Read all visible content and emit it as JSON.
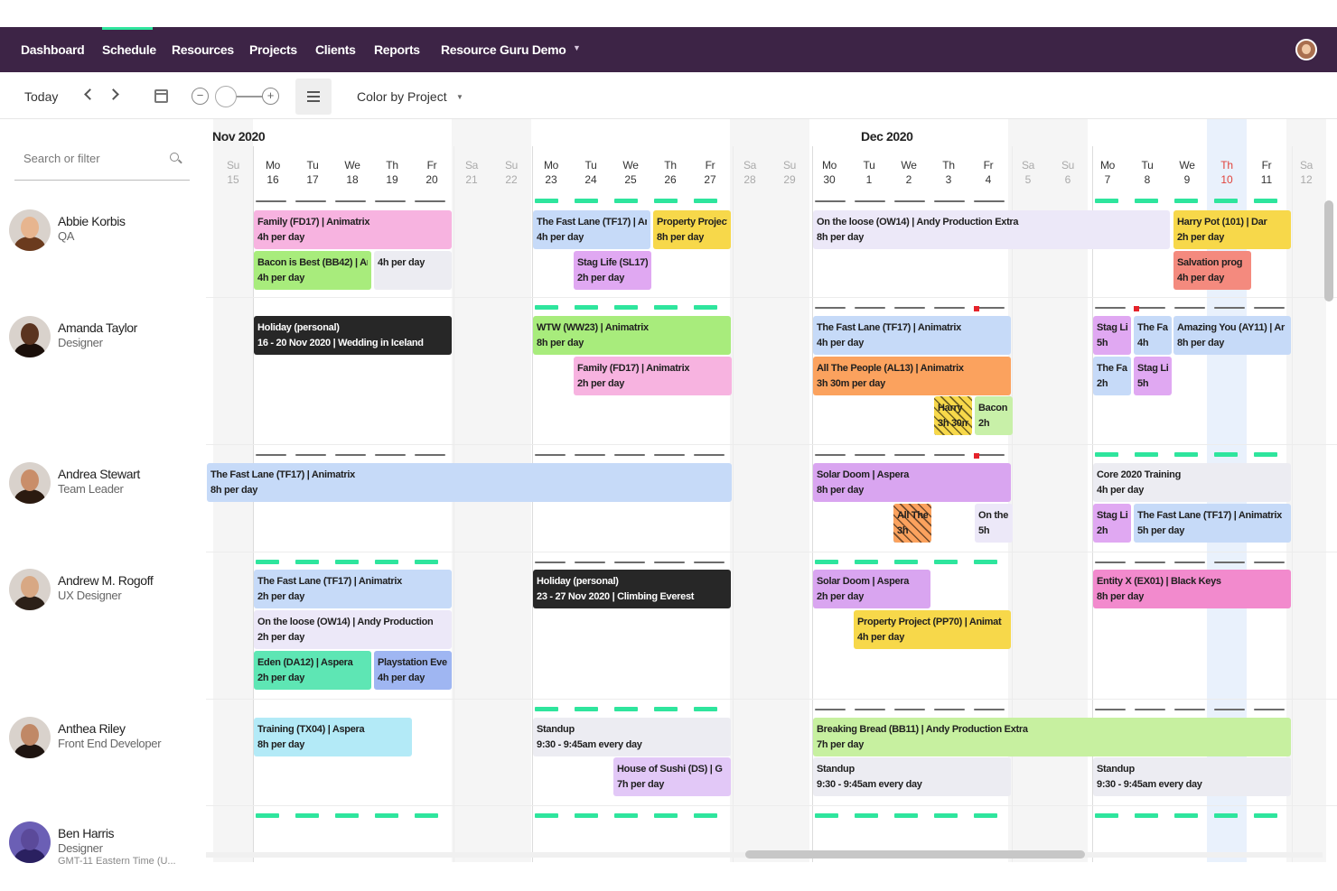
{
  "nav": {
    "items": [
      "Dashboard",
      "Schedule",
      "Resources",
      "Projects",
      "Clients",
      "Reports",
      "Resource Guru Demo"
    ],
    "active": "Schedule",
    "accent": "#2ee59d",
    "bar_color": "#3d2446"
  },
  "toolbar": {
    "today_label": "Today",
    "color_by_label": "Color by Project",
    "zoom_out_symbol": "−",
    "zoom_in_symbol": "+"
  },
  "search": {
    "placeholder": "Search or filter"
  },
  "months": [
    "Nov 2020",
    "Dec 2020"
  ],
  "days": [
    {
      "wd": "Su",
      "dn": "15",
      "weekend": true
    },
    {
      "wd": "Mo",
      "dn": "16"
    },
    {
      "wd": "Tu",
      "dn": "17"
    },
    {
      "wd": "We",
      "dn": "18"
    },
    {
      "wd": "Th",
      "dn": "19"
    },
    {
      "wd": "Fr",
      "dn": "20"
    },
    {
      "wd": "Sa",
      "dn": "21",
      "weekend": true
    },
    {
      "wd": "Su",
      "dn": "22",
      "weekend": true
    },
    {
      "wd": "Mo",
      "dn": "23"
    },
    {
      "wd": "Tu",
      "dn": "24"
    },
    {
      "wd": "We",
      "dn": "25"
    },
    {
      "wd": "Th",
      "dn": "26"
    },
    {
      "wd": "Fr",
      "dn": "27"
    },
    {
      "wd": "Sa",
      "dn": "28",
      "weekend": true
    },
    {
      "wd": "Su",
      "dn": "29",
      "weekend": true
    },
    {
      "wd": "Mo",
      "dn": "30"
    },
    {
      "wd": "Tu",
      "dn": "1"
    },
    {
      "wd": "We",
      "dn": "2"
    },
    {
      "wd": "Th",
      "dn": "3"
    },
    {
      "wd": "Fr",
      "dn": "4"
    },
    {
      "wd": "Sa",
      "dn": "5",
      "weekend": true
    },
    {
      "wd": "Su",
      "dn": "6",
      "weekend": true
    },
    {
      "wd": "Mo",
      "dn": "7"
    },
    {
      "wd": "Tu",
      "dn": "8"
    },
    {
      "wd": "We",
      "dn": "9"
    },
    {
      "wd": "Th",
      "dn": "10",
      "today": true
    },
    {
      "wd": "Fr",
      "dn": "11"
    },
    {
      "wd": "Sa",
      "dn": "12",
      "weekend": true
    }
  ],
  "people": [
    {
      "name": "Abbie Korbis",
      "role": "QA",
      "skin": "#e7b58f",
      "hair": "#6b3b1e"
    },
    {
      "name": "Amanda Taylor",
      "role": "Designer",
      "skin": "#5a3420",
      "hair": "#1a0f0a"
    },
    {
      "name": "Andrea Stewart",
      "role": "Team Leader",
      "skin": "#c98e6a",
      "hair": "#2b1a10"
    },
    {
      "name": "Andrew M. Rogoff",
      "role": "UX Designer",
      "skin": "#d8a884",
      "hair": "#2c2018"
    },
    {
      "name": "Anthea Riley",
      "role": "Front End Developer",
      "skin": "#c08866",
      "hair": "#1e1410"
    },
    {
      "name": "Ben Harris",
      "role": "Designer",
      "extra": "GMT-11 Eastern Time (U...",
      "skin": "#5b4a9a",
      "hair": "#2a2060"
    }
  ],
  "bookings": [
    {
      "row": 0,
      "title": "Family (FD17) | Animatrix",
      "sub": "4h per day",
      "color": "#f7b3e0"
    },
    {
      "row": 0,
      "title": "Bacon is Best (BB42) | Ar",
      "sub": "4h per day",
      "color": "#a8ec7c"
    },
    {
      "row": 0,
      "title": "4h per day",
      "sub": "",
      "color": "#ececf2"
    },
    {
      "row": 0,
      "title": "The Fast Lane (TF17) | Ar",
      "sub": "4h per day",
      "color": "#c6daf8"
    },
    {
      "row": 0,
      "title": "Property Project",
      "sub": "8h per day",
      "color": "#f7d84a"
    },
    {
      "row": 0,
      "title": "Stag Life (SL17)",
      "sub": "2h per day",
      "color": "#e0a8f2"
    },
    {
      "row": 0,
      "title": "On the loose (OW14) | Andy Production Extra",
      "sub": "8h per day",
      "color": "#ece8f8"
    },
    {
      "row": 0,
      "title": "Harry Pot (101) | Dar",
      "sub": "2h per day",
      "color": "#f7d84a"
    },
    {
      "row": 0,
      "title": "Salvation prog",
      "sub": "4h per day",
      "color": "#f48a7e"
    },
    {
      "row": 1,
      "title": "Holiday (personal)",
      "sub": "16 - 20 Nov 2020 | Wedding in Iceland",
      "color": "#272727",
      "dark": true
    },
    {
      "row": 1,
      "title": "WTW (WW23) | Animatrix",
      "sub": "8h per day",
      "color": "#a8ec7c"
    },
    {
      "row": 1,
      "title": "Family (FD17) | Animatrix",
      "sub": "2h per day",
      "color": "#f7b3e0"
    },
    {
      "row": 1,
      "title": "The Fast Lane (TF17) | Animatrix",
      "sub": "4h per day",
      "color": "#c6daf8"
    },
    {
      "row": 1,
      "title": "All The People (AL13) | Animatrix",
      "sub": "3h 30m per day",
      "color": "#fba25e"
    },
    {
      "row": 1,
      "title": "Harry",
      "sub": "3h 30m",
      "color": "#f7d84a",
      "hatch": true
    },
    {
      "row": 1,
      "title": "Bacon",
      "sub": "2h",
      "color": "#c8f0a8"
    },
    {
      "row": 1,
      "title": "Stag Li",
      "sub": "5h",
      "color": "#e0a8f2"
    },
    {
      "row": 1,
      "title": "The Fa",
      "sub": "4h",
      "color": "#c6daf8"
    },
    {
      "row": 1,
      "title": "Amazing You (AY11) | Ar",
      "sub": "8h per day",
      "color": "#c6daf8"
    },
    {
      "row": 1,
      "title": "The Fa",
      "sub": "2h",
      "color": "#c6daf8"
    },
    {
      "row": 1,
      "title": "Stag Li",
      "sub": "5h",
      "color": "#e0a8f2"
    },
    {
      "row": 2,
      "title": "The Fast Lane (TF17) | Animatrix",
      "sub": "8h per day",
      "color": "#c6daf8"
    },
    {
      "row": 2,
      "title": "Solar Doom | Aspera",
      "sub": "8h per day",
      "color": "#d9a5f0"
    },
    {
      "row": 2,
      "title": "All The",
      "sub": "3h",
      "color": "#fba25e",
      "hatch": true
    },
    {
      "row": 2,
      "title": "On the",
      "sub": "5h",
      "color": "#ece8f8"
    },
    {
      "row": 2,
      "title": "Core 2020 Training",
      "sub": "4h per day",
      "color": "#ececf2"
    },
    {
      "row": 2,
      "title": "Stag Li",
      "sub": "2h",
      "color": "#e0a8f2"
    },
    {
      "row": 2,
      "title": "The Fast Lane (TF17) | Animatrix",
      "sub": "5h per day",
      "color": "#c6daf8"
    },
    {
      "row": 3,
      "title": "The Fast Lane (TF17) | Animatrix",
      "sub": "2h per day",
      "color": "#c6daf8"
    },
    {
      "row": 3,
      "title": "On the loose (OW14) | Andy Production",
      "sub": "2h per day",
      "color": "#ece8f8"
    },
    {
      "row": 3,
      "title": "Eden (DA12) | Aspera",
      "sub": "2h per day",
      "color": "#5ee6b4"
    },
    {
      "row": 3,
      "title": "Playstation Eve",
      "sub": "4h per day",
      "color": "#9fb6f2"
    },
    {
      "row": 3,
      "title": "Holiday (personal)",
      "sub": "23 - 27 Nov 2020 | Climbing Everest",
      "color": "#272727",
      "dark": true
    },
    {
      "row": 3,
      "title": "Solar Doom | Aspera",
      "sub": "2h per day",
      "color": "#d9a5f0"
    },
    {
      "row": 3,
      "title": "Property Project (PP70) | Animat",
      "sub": "4h per day",
      "color": "#f7d84a"
    },
    {
      "row": 3,
      "title": "Entity X (EX01) | Black Keys",
      "sub": "8h per day",
      "color": "#f28acd"
    },
    {
      "row": 4,
      "title": "Training (TX04) | Aspera",
      "sub": "8h per day",
      "color": "#b3eaf7"
    },
    {
      "row": 4,
      "title": "Standup",
      "sub": "9:30 - 9:45am every day",
      "color": "#ececf2"
    },
    {
      "row": 4,
      "title": "House of Sushi (DS) | G",
      "sub": "7h per day",
      "color": "#e2c8f7"
    },
    {
      "row": 4,
      "title": "Breaking Bread (BB11) | Andy Production Extra",
      "sub": "7h per day",
      "color": "#c7f0a0"
    },
    {
      "row": 4,
      "title": "Standup",
      "sub": "9:30 - 9:45am every day",
      "color": "#ececf2"
    },
    {
      "row": 4,
      "title": "Standup",
      "sub": "9:30 - 9:45am every day",
      "color": "#ececf2"
    }
  ]
}
